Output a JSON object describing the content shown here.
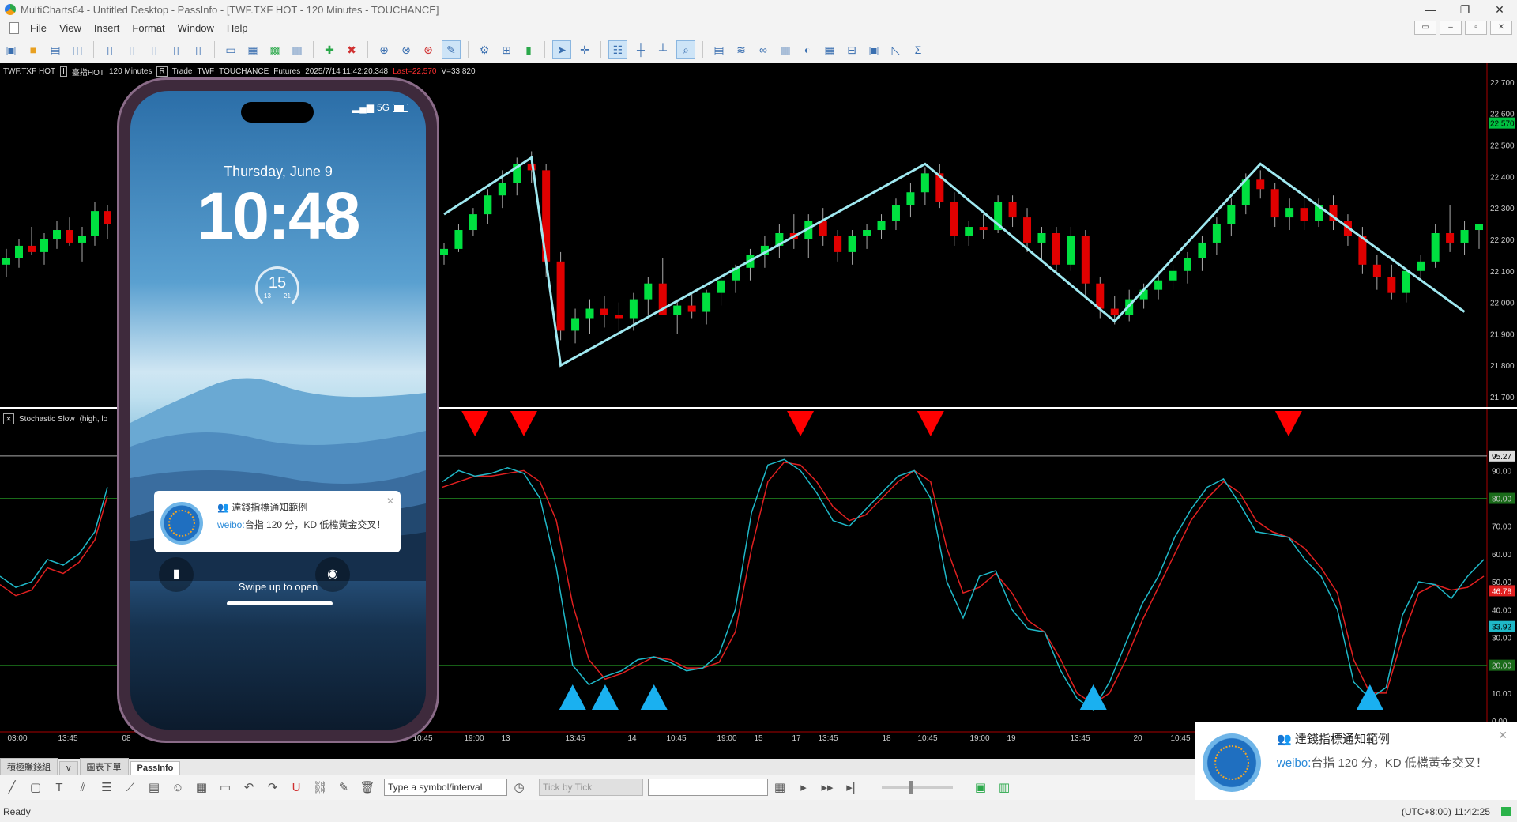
{
  "window": {
    "title": "MultiCharts64 - Untitled Desktop - PassInfo - [TWF.TXF HOT - 120 Minutes - TOUCHANCE]",
    "controls": [
      "—",
      "❐",
      "✕"
    ]
  },
  "menu": {
    "items": [
      "File",
      "View",
      "Insert",
      "Format",
      "Window",
      "Help"
    ],
    "mdi_controls": [
      "▭",
      "–",
      "▫",
      "✕"
    ]
  },
  "chart_header": {
    "symbol": "TWF.TXF HOT",
    "interval_box": "I",
    "desc": "臺指HOT",
    "interval": "120 Minutes",
    "range_box": "R",
    "trade": "Trade",
    "exchange": "TWF",
    "source": "TOUCHANCE",
    "category": "Futures",
    "datetime": "2025/7/14 11:42:20.348",
    "last": "Last=22,570",
    "volume": "V=33,820"
  },
  "price_axis": {
    "labels": [
      "22,700",
      "22,600",
      "22,570",
      "22,500",
      "22,400",
      "22,300",
      "22,200",
      "22,100",
      "22,000",
      "21,900",
      "21,800",
      "21,700"
    ],
    "values": [
      22700,
      22600,
      22570,
      22500,
      22400,
      22300,
      22200,
      22100,
      22000,
      21900,
      21800,
      21700
    ],
    "last_value": 22570,
    "last_color": "#00c040"
  },
  "stoch_axis": {
    "labels": [
      "95.27",
      "90.00",
      "80.00",
      "70.00",
      "60.00",
      "50.00",
      "46.78",
      "40.00",
      "33.92",
      "30.00",
      "20.00",
      "10.00",
      "0.00"
    ],
    "values": [
      95.27,
      90,
      80,
      70,
      60,
      50,
      46.78,
      40,
      33.92,
      30,
      20,
      10,
      0
    ]
  },
  "indicator": {
    "label": "Stochastic Slow",
    "params": "(high,  lo"
  },
  "time_axis": {
    "labels": [
      "03:00",
      "13:45",
      "08",
      "10:45",
      "19:00",
      "13",
      "13:45",
      "14",
      "10:45",
      "19:00",
      "15",
      "17",
      "13:45",
      "18",
      "10:45",
      "19:00",
      "19",
      "13:45",
      "20",
      "10:45"
    ]
  },
  "chart_data": {
    "type": "candlestick",
    "candles": [
      [
        22150,
        22190,
        22120,
        22170
      ],
      [
        22170,
        22250,
        22160,
        22230
      ],
      [
        22230,
        22300,
        22210,
        22280
      ],
      [
        22280,
        22360,
        22250,
        22340
      ],
      [
        22340,
        22420,
        22300,
        22380
      ],
      [
        22380,
        22460,
        22340,
        22440
      ],
      [
        22440,
        22480,
        22380,
        22420
      ],
      [
        22420,
        22440,
        22080,
        22130
      ],
      [
        22130,
        22160,
        21880,
        21910
      ],
      [
        21910,
        21980,
        21870,
        21950
      ],
      [
        21950,
        22010,
        21900,
        21980
      ],
      [
        21980,
        22020,
        21920,
        21960
      ],
      [
        21960,
        22000,
        21890,
        21950
      ],
      [
        21950,
        22030,
        21910,
        22010
      ],
      [
        22010,
        22080,
        21960,
        22060
      ],
      [
        22060,
        22140,
        22020,
        21960
      ],
      [
        21960,
        22010,
        21900,
        21990
      ],
      [
        21990,
        22030,
        21950,
        21970
      ],
      [
        21970,
        22040,
        21930,
        22030
      ],
      [
        22030,
        22090,
        21990,
        22070
      ],
      [
        22070,
        22120,
        22030,
        22110
      ],
      [
        22110,
        22170,
        22070,
        22150
      ],
      [
        22150,
        22210,
        22110,
        22180
      ],
      [
        22180,
        22250,
        22140,
        22220
      ],
      [
        22220,
        22280,
        22170,
        22200
      ],
      [
        22200,
        22280,
        22140,
        22260
      ],
      [
        22260,
        22300,
        22180,
        22210
      ],
      [
        22210,
        22230,
        22130,
        22160
      ],
      [
        22160,
        22230,
        22120,
        22210
      ],
      [
        22210,
        22250,
        22170,
        22230
      ],
      [
        22230,
        22280,
        22200,
        22260
      ],
      [
        22260,
        22330,
        22230,
        22310
      ],
      [
        22310,
        22380,
        22270,
        22350
      ],
      [
        22350,
        22430,
        22310,
        22410
      ],
      [
        22410,
        22440,
        22300,
        22320
      ],
      [
        22320,
        22350,
        22180,
        22210
      ],
      [
        22210,
        22260,
        22180,
        22240
      ],
      [
        22240,
        22280,
        22200,
        22230
      ],
      [
        22230,
        22340,
        22220,
        22320
      ],
      [
        22320,
        22340,
        22240,
        22270
      ],
      [
        22270,
        22300,
        22160,
        22190
      ],
      [
        22190,
        22240,
        22130,
        22220
      ],
      [
        22220,
        22240,
        22090,
        22120
      ],
      [
        22120,
        22240,
        22100,
        22210
      ],
      [
        22210,
        22230,
        22020,
        22060
      ],
      [
        22060,
        22080,
        21950,
        21980
      ],
      [
        21980,
        22020,
        21930,
        21960
      ],
      [
        21960,
        22040,
        21940,
        22010
      ],
      [
        22010,
        22060,
        21980,
        22040
      ],
      [
        22040,
        22100,
        22010,
        22070
      ],
      [
        22070,
        22120,
        22040,
        22100
      ],
      [
        22100,
        22160,
        22060,
        22140
      ],
      [
        22140,
        22210,
        22100,
        22190
      ],
      [
        22190,
        22270,
        22150,
        22250
      ],
      [
        22250,
        22330,
        22210,
        22310
      ],
      [
        22310,
        22410,
        22280,
        22390
      ],
      [
        22390,
        22420,
        22330,
        22360
      ],
      [
        22360,
        22380,
        22240,
        22270
      ],
      [
        22270,
        22330,
        22230,
        22300
      ],
      [
        22300,
        22350,
        22230,
        22260
      ],
      [
        22260,
        22330,
        22240,
        22310
      ],
      [
        22310,
        22340,
        22230,
        22260
      ],
      [
        22260,
        22280,
        22180,
        22210
      ],
      [
        22210,
        22240,
        22090,
        22120
      ],
      [
        22120,
        22150,
        22040,
        22080
      ],
      [
        22080,
        22120,
        22010,
        22030
      ],
      [
        22030,
        22110,
        22000,
        22100
      ],
      [
        22100,
        22150,
        22070,
        22130
      ],
      [
        22130,
        22250,
        22110,
        22220
      ],
      [
        22220,
        22310,
        22160,
        22190
      ],
      [
        22190,
        22260,
        22150,
        22230
      ],
      [
        22230,
        22250,
        22170,
        22250
      ]
    ],
    "overlay_line": [
      [
        0,
        22280
      ],
      [
        6,
        22460
      ],
      [
        8,
        21800
      ],
      [
        33,
        22440
      ],
      [
        46,
        21940
      ],
      [
        56,
        22440
      ],
      [
        70,
        21970
      ]
    ],
    "stoch_k": [
      86,
      90,
      88,
      89,
      91,
      89,
      80,
      55,
      20,
      13,
      16,
      18,
      22,
      23,
      21,
      18,
      19,
      24,
      40,
      75,
      92,
      94,
      90,
      82,
      72,
      70,
      76,
      82,
      88,
      90,
      80,
      50,
      37,
      52,
      54,
      40,
      33,
      32,
      18,
      8,
      4,
      14,
      28,
      42,
      52,
      66,
      76,
      84,
      87,
      78,
      68,
      67,
      66,
      58,
      52,
      40,
      14,
      8,
      12,
      38,
      50,
      49,
      44,
      52,
      58
    ],
    "stoch_d": [
      84,
      86,
      88,
      88,
      89,
      90,
      86,
      72,
      42,
      22,
      15,
      17,
      20,
      23,
      22,
      19,
      19,
      21,
      32,
      62,
      86,
      93,
      92,
      86,
      77,
      72,
      74,
      80,
      86,
      90,
      86,
      62,
      46,
      48,
      53,
      46,
      36,
      32,
      22,
      10,
      6,
      10,
      22,
      36,
      48,
      60,
      72,
      80,
      86,
      82,
      72,
      68,
      66,
      62,
      55,
      46,
      22,
      10,
      10,
      30,
      46,
      49,
      47,
      48,
      52
    ],
    "stoch_k_color": "#1fb8c8",
    "stoch_d_color": "#e02020",
    "sell_markers": [
      2,
      5,
      22,
      30,
      52
    ],
    "buy_markers": [
      8,
      10,
      13,
      40,
      57
    ],
    "up_color": "#00e040",
    "down_color": "#e00000",
    "overlay_color": "#9fe8f0",
    "marker_sell_color": "#ff0000",
    "marker_buy_color": "#1ab0f0"
  },
  "bottom_tabs": [
    "積極賺錢組",
    "v",
    "圖表下單",
    "PassInfo"
  ],
  "drawbar": {
    "symbol_placeholder": "Type a symbol/interval",
    "tick_mode": "Tick by Tick"
  },
  "status": {
    "ready": "Ready",
    "clock": "(UTC+8:00) 11:42:25"
  },
  "phone": {
    "signal": "5G",
    "date": "Thursday, June 9",
    "time": "10:48",
    "widget_value": "15",
    "widget_low": "13",
    "widget_high": "21",
    "notif_title": "達錢指標通知範例",
    "notif_source": "weibo:",
    "notif_body": "台指 120 分，KD 低檔黃金交叉！",
    "swipe": "Swipe up to open",
    "close": "✕"
  },
  "desktop_notif": {
    "title": "達錢指標通知範例",
    "source": "weibo:",
    "body": "台指 120 分，KD 低檔黃金交叉！",
    "close": "✕"
  }
}
